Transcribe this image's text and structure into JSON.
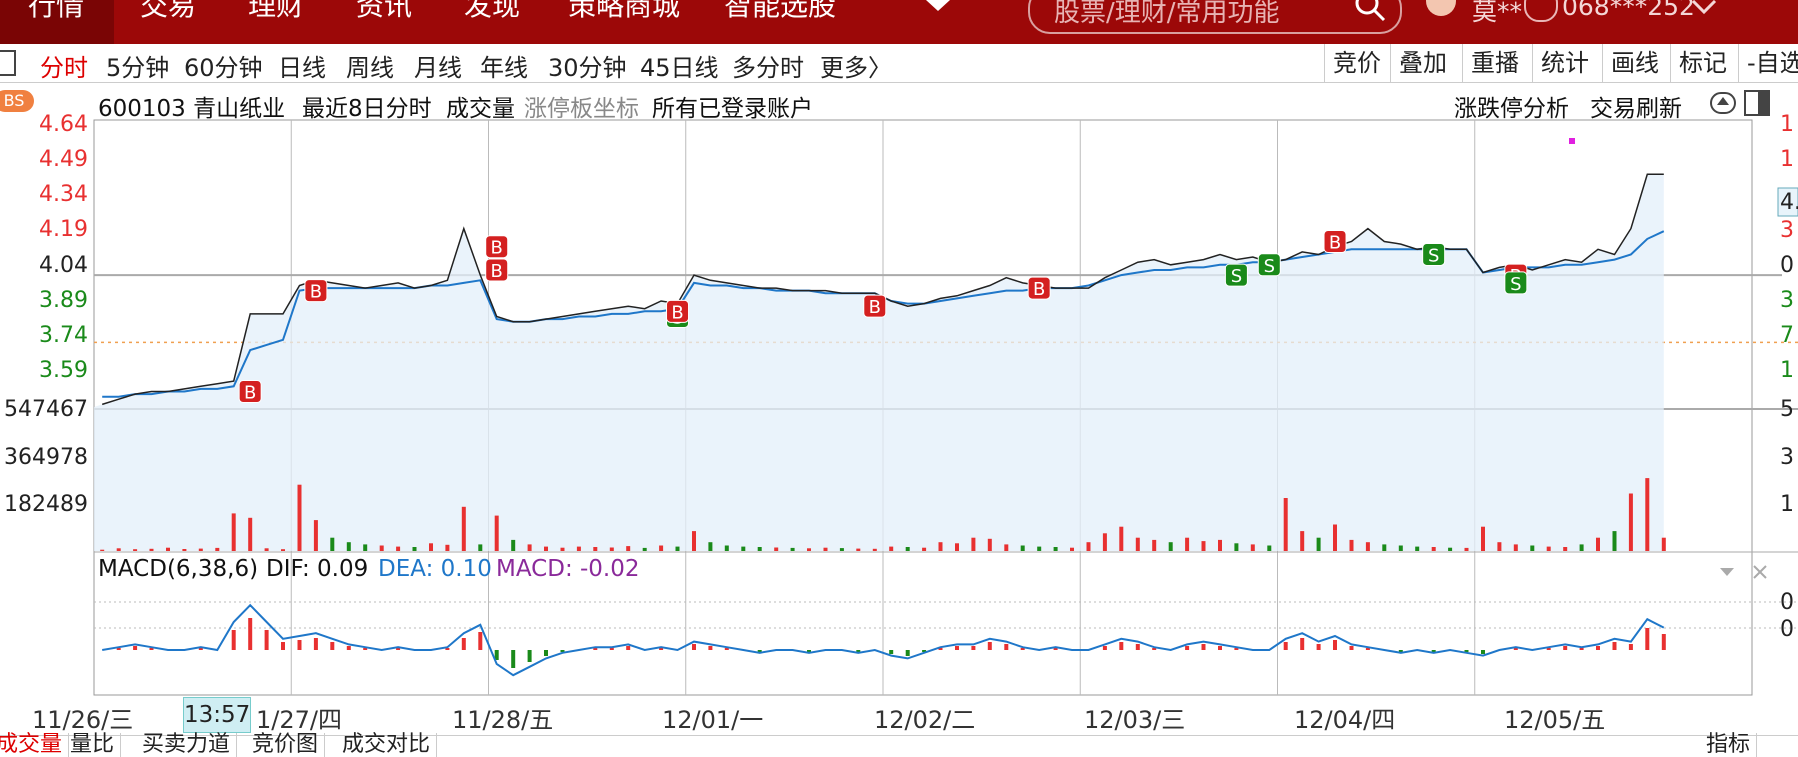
{
  "nav": {
    "items": [
      "行情",
      "交易",
      "理财",
      "资讯",
      "发现",
      "策略商城",
      "智能选股"
    ],
    "search_placeholder": "股票/理财/常用功能",
    "user_name": "莫**",
    "account": "068***252"
  },
  "periods": {
    "tabs": [
      "分时",
      "5分钟",
      "60分钟",
      "日线",
      "周线",
      "月线",
      "年线",
      "30分钟",
      "45日线",
      "多分时",
      "更多〉"
    ],
    "right_tabs": [
      "竞价",
      "叠加",
      "重播",
      "统计",
      "画线",
      "标记",
      "-自选"
    ]
  },
  "info": {
    "badge": "BS",
    "code_name": "600103 青山纸业",
    "mode": "最近8日分时",
    "volume_label": "成交量",
    "limit_axis": "涨停板坐标",
    "accounts": "所有已登录账户",
    "limit_analysis": "涨跌停分析",
    "trade_refresh": "交易刷新"
  },
  "axes": {
    "price_ticks": [
      "4.64",
      "4.49",
      "4.34",
      "4.19",
      "4.04",
      "3.89",
      "3.74",
      "3.59"
    ],
    "volume_ticks": [
      "547467",
      "364978",
      "182489"
    ],
    "right_ticks": [
      "1",
      "1",
      "4.",
      "3",
      "0",
      "3",
      "7",
      "1",
      "5",
      "3",
      "1",
      "0",
      "0"
    ],
    "dates": [
      "11/26/三",
      "1/27/四",
      "11/28/五",
      "12/01/一",
      "12/02/二",
      "12/03/三",
      "12/04/四",
      "12/05/五"
    ],
    "cursor_time": "13:57"
  },
  "macd": {
    "title": "MACD(6,38,6)",
    "dif": "DIF: 0.09",
    "dea": "DEA: 0.10",
    "macd": "MACD: -0.02"
  },
  "bottom_tabs": [
    "成交量",
    "量比",
    "买卖力道",
    "竞价图",
    "成交对比",
    "指标"
  ],
  "colors": {
    "brand": "#9c0808",
    "up": "#e83030",
    "down": "#1a8a1a",
    "avg": "#1f77c9",
    "price": "#222222"
  },
  "chart_data": {
    "type": "line",
    "title": "600103 青山纸业 最近8日分时",
    "days": [
      "11/26",
      "11/27",
      "11/28",
      "12/01",
      "12/02",
      "12/03",
      "12/04",
      "12/05"
    ],
    "ylim": [
      3.53,
      4.64
    ],
    "price_ref": 4.04,
    "price": [
      [
        3.54,
        3.56,
        3.58,
        3.59,
        3.59,
        3.6,
        3.61,
        3.62,
        3.63,
        3.89,
        3.89,
        3.89
      ],
      [
        4.0,
        4.02,
        4.01,
        4.0,
        3.99,
        4.0,
        4.01,
        3.99,
        4.0,
        4.02,
        4.22,
        4.04
      ],
      [
        3.88,
        3.86,
        3.86,
        3.87,
        3.88,
        3.89,
        3.9,
        3.91,
        3.92,
        3.91,
        3.94,
        3.93
      ],
      [
        4.04,
        4.02,
        4.01,
        4.0,
        3.99,
        3.99,
        3.98,
        3.98,
        3.98,
        3.97,
        3.97,
        3.97
      ],
      [
        3.94,
        3.92,
        3.93,
        3.95,
        3.96,
        3.98,
        4.0,
        4.03,
        4.01,
        4.0,
        3.99,
        3.99
      ],
      [
        3.99,
        4.03,
        4.06,
        4.09,
        4.1,
        4.08,
        4.09,
        4.1,
        4.12,
        4.1,
        4.11,
        4.09
      ],
      [
        4.1,
        4.13,
        4.12,
        4.15,
        4.17,
        4.22,
        4.17,
        4.16,
        4.14,
        4.15,
        4.14,
        4.14
      ],
      [
        4.05,
        4.07,
        4.08,
        4.06,
        4.08,
        4.1,
        4.09,
        4.14,
        4.12,
        4.22,
        4.43,
        4.43
      ]
    ],
    "avg_price": [
      [
        3.57,
        3.57,
        3.58,
        3.58,
        3.59,
        3.59,
        3.6,
        3.6,
        3.61,
        3.75,
        3.77,
        3.79
      ],
      [
        3.98,
        3.99,
        3.99,
        3.99,
        3.99,
        3.99,
        3.99,
        3.99,
        4.0,
        4.0,
        4.01,
        4.02
      ],
      [
        3.87,
        3.86,
        3.86,
        3.87,
        3.87,
        3.88,
        3.88,
        3.89,
        3.89,
        3.9,
        3.9,
        3.91
      ],
      [
        4.01,
        4.0,
        4.0,
        3.99,
        3.99,
        3.98,
        3.98,
        3.98,
        3.97,
        3.97,
        3.97,
        3.97
      ],
      [
        3.94,
        3.93,
        3.93,
        3.94,
        3.95,
        3.96,
        3.97,
        3.98,
        3.98,
        3.99,
        3.99,
        3.99
      ],
      [
        4.0,
        4.02,
        4.04,
        4.05,
        4.06,
        4.06,
        4.07,
        4.07,
        4.08,
        4.08,
        4.09,
        4.09
      ],
      [
        4.1,
        4.11,
        4.12,
        4.13,
        4.14,
        4.14,
        4.14,
        4.14,
        4.14,
        4.14,
        4.14,
        4.14
      ],
      [
        4.05,
        4.06,
        4.07,
        4.07,
        4.07,
        4.08,
        4.08,
        4.09,
        4.1,
        4.12,
        4.18,
        4.21
      ]
    ],
    "volume_ylim": [
      0,
      547467
    ],
    "volume": [
      [
        6000,
        12000,
        8000,
        10000,
        15000,
        9000,
        11000,
        14000,
        170000,
        150000,
        12000,
        8000
      ],
      [
        300000,
        140000,
        60000,
        40000,
        30000,
        25000,
        20000,
        18000,
        35000,
        28000,
        200000,
        30000
      ],
      [
        160000,
        50000,
        30000,
        20000,
        15000,
        20000,
        18000,
        16000,
        22000,
        14000,
        25000,
        20000
      ],
      [
        90000,
        40000,
        25000,
        20000,
        18000,
        16000,
        14000,
        12000,
        15000,
        13000,
        11000,
        10000
      ],
      [
        20000,
        18000,
        15000,
        40000,
        35000,
        60000,
        55000,
        30000,
        25000,
        20000,
        18000,
        15000
      ],
      [
        40000,
        80000,
        110000,
        60000,
        50000,
        40000,
        60000,
        45000,
        50000,
        35000,
        30000,
        25000
      ],
      [
        240000,
        90000,
        60000,
        120000,
        50000,
        40000,
        30000,
        25000,
        20000,
        18000,
        15000,
        14000
      ],
      [
        110000,
        40000,
        30000,
        25000,
        20000,
        18000,
        30000,
        60000,
        90000,
        260000,
        330000,
        60000
      ]
    ],
    "trades": [
      {
        "day": "11/26",
        "slot": 9,
        "side": "B",
        "price": 3.59
      },
      {
        "day": "11/27",
        "slot": 1,
        "side": "B",
        "price": 3.98
      },
      {
        "day": "11/28",
        "slot": 0,
        "side": "B",
        "price": 4.15
      },
      {
        "day": "11/28",
        "slot": 0,
        "side": "B",
        "price": 4.06
      },
      {
        "day": "11/28",
        "slot": 11,
        "side": "S",
        "price": 3.88
      },
      {
        "day": "11/28",
        "slot": 11,
        "side": "B",
        "price": 3.9
      },
      {
        "day": "12/01",
        "slot": 11,
        "side": "B",
        "price": 3.92
      },
      {
        "day": "12/02",
        "slot": 9,
        "side": "B",
        "price": 3.99
      },
      {
        "day": "12/03",
        "slot": 9,
        "side": "S",
        "price": 4.04
      },
      {
        "day": "12/03",
        "slot": 11,
        "side": "S",
        "price": 4.08
      },
      {
        "day": "12/04",
        "slot": 3,
        "side": "B",
        "price": 4.17
      },
      {
        "day": "12/04",
        "slot": 9,
        "side": "S",
        "price": 4.12
      },
      {
        "day": "12/05",
        "slot": 2,
        "side": "B",
        "price": 4.04
      },
      {
        "day": "12/05",
        "slot": 2,
        "side": "S",
        "price": 4.01
      }
    ],
    "macd_dif": [
      [
        0,
        0.01,
        0.02,
        0.01,
        0.0,
        0.0,
        0.01,
        0.0,
        0.1,
        0.16,
        0.1,
        0.04
      ],
      [
        0.05,
        0.06,
        0.04,
        0.02,
        0.01,
        0.0,
        0.01,
        0.0,
        0.0,
        0.01,
        0.06,
        0.09
      ],
      [
        -0.05,
        -0.09,
        -0.06,
        -0.03,
        -0.01,
        0.0,
        0.01,
        0.01,
        0.02,
        0.0,
        0.01,
        0.0
      ],
      [
        0.03,
        0.02,
        0.01,
        0.0,
        -0.01,
        0.0,
        0.0,
        -0.01,
        0.0,
        0.0,
        -0.01,
        0.0
      ],
      [
        -0.02,
        -0.03,
        -0.01,
        0.01,
        0.02,
        0.02,
        0.04,
        0.03,
        0.01,
        0.0,
        0.01,
        0.0
      ],
      [
        0.0,
        0.02,
        0.04,
        0.03,
        0.01,
        0.0,
        0.02,
        0.03,
        0.02,
        0.01,
        0.0,
        0.0
      ],
      [
        0.04,
        0.06,
        0.03,
        0.05,
        0.02,
        0.01,
        0.0,
        -0.01,
        0.0,
        -0.01,
        0.0,
        -0.01
      ],
      [
        -0.02,
        0.0,
        0.01,
        0.0,
        0.01,
        0.02,
        0.01,
        0.02,
        0.04,
        0.03,
        0.11,
        0.08
      ]
    ]
  }
}
